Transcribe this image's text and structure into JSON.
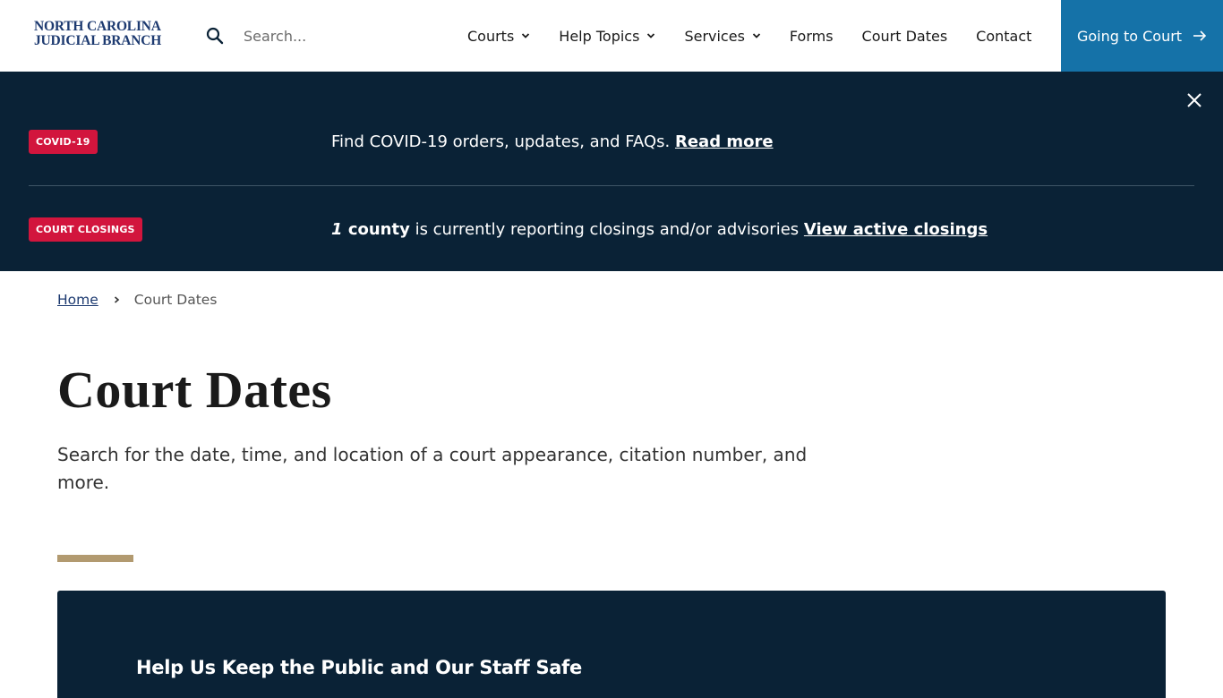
{
  "header": {
    "logo_line1": "NORTH CAROLINA",
    "logo_line2": "JUDICIAL BRANCH",
    "search_placeholder": "Search...",
    "nav": [
      {
        "label": "Courts",
        "dropdown": true
      },
      {
        "label": "Help Topics",
        "dropdown": true
      },
      {
        "label": "Services",
        "dropdown": true
      },
      {
        "label": "Forms",
        "dropdown": false
      },
      {
        "label": "Court Dates",
        "dropdown": false
      },
      {
        "label": "Contact",
        "dropdown": false
      }
    ],
    "cta_label": "Going to Court"
  },
  "alerts": {
    "covid": {
      "tag": "COVID-19",
      "text": "Find COVID-19 orders, updates, and FAQs.",
      "link": "Read more"
    },
    "closings": {
      "tag": "COURT CLOSINGS",
      "count": "1",
      "count_suffix": "county",
      "text": "is currently reporting closings and/or advisories",
      "link": "View active closings"
    }
  },
  "breadcrumb": {
    "home": "Home",
    "current": "Court Dates"
  },
  "main": {
    "title": "Court Dates",
    "intro": "Search for the date, time, and location of a court appearance, citation number, and more.",
    "panel_title": "Help Us Keep the Public and Our Staff Safe"
  },
  "colors": {
    "brand_navy": "#1d3a70",
    "cta_blue": "#1572a8",
    "banner_bg": "#0a2236",
    "tag_red": "#d2153d",
    "accent_gold": "#b29a70"
  }
}
